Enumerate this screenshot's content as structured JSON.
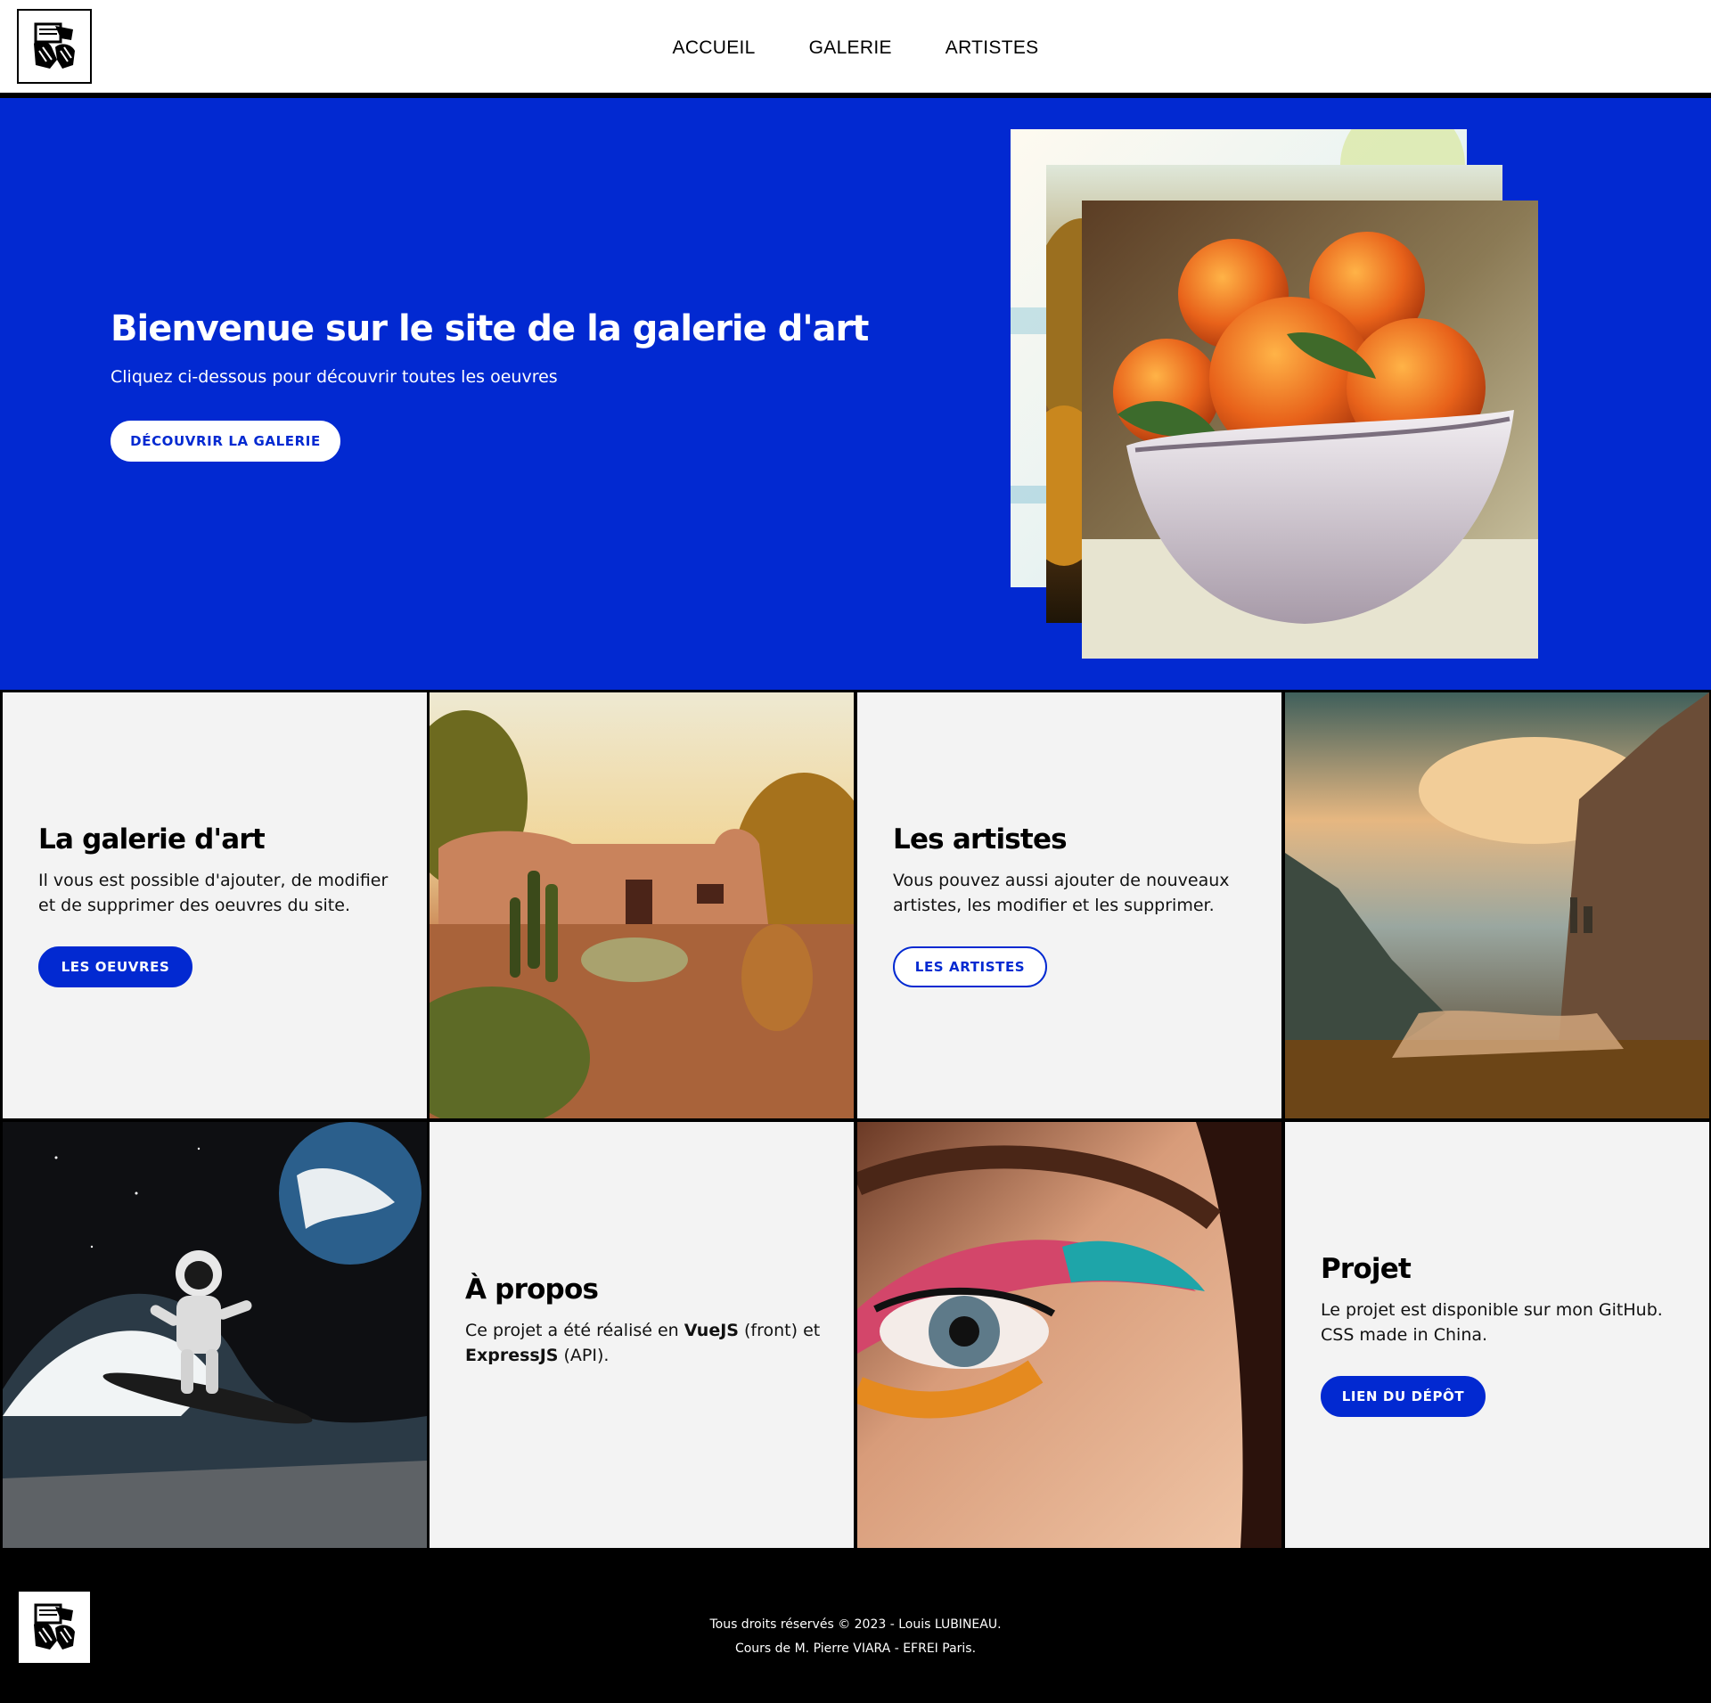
{
  "header": {
    "nav": [
      {
        "label": "ACCUEIL"
      },
      {
        "label": "GALERIE"
      },
      {
        "label": "ARTISTES"
      }
    ]
  },
  "hero": {
    "title": "Bienvenue sur le site de la galerie d'art",
    "subtitle": "Cliquez ci-dessous pour découvrir toutes les oeuvres",
    "button": "DÉCOUVRIR LA GALERIE"
  },
  "cards": {
    "gallery": {
      "title": "La galerie d'art",
      "text": "Il vous est possible d'ajouter, de modifier et de supprimer des oeuvres du site.",
      "button": "LES OEUVRES"
    },
    "artists": {
      "title": "Les artistes",
      "text": "Vous pouvez aussi ajouter de nouveaux artistes, les modifier et les supprimer.",
      "button": "LES ARTISTES"
    },
    "about": {
      "title": "À propos",
      "text_1": "Ce projet a été réalisé en ",
      "text_bold_1": "VueJS",
      "text_2": " (front) et ",
      "text_bold_2": "ExpressJS",
      "text_3": " (API)."
    },
    "project": {
      "title": "Projet",
      "text": "Le projet est disponible sur mon GitHub. CSS made in China.",
      "button": "LIEN DU DÉPÔT"
    }
  },
  "footer": {
    "line1": "Tous droits réservés © 2023 - Louis LUBINEAU.",
    "line2": "Cours de M. Pierre VIARA - EFREI Paris."
  },
  "colors": {
    "accent": "#0229d1",
    "card_bg": "#f3f3f3",
    "footer_bg": "#000000"
  }
}
